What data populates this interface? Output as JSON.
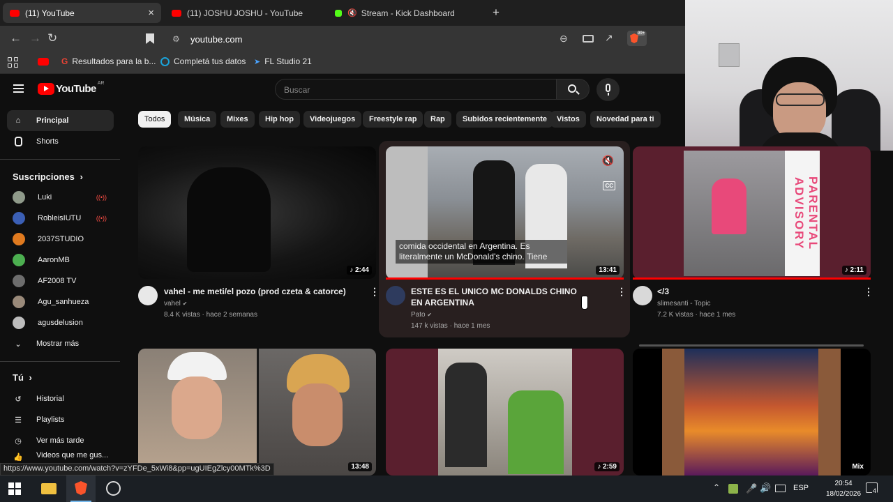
{
  "browser": {
    "tabs": [
      {
        "label": "(11) YouTube",
        "active": true
      },
      {
        "label": "(11) JOSHU JOSHU - YouTube",
        "active": false
      },
      {
        "label": "Stream - Kick Dashboard",
        "active": false
      }
    ],
    "new_tab": "+",
    "close_tab": "×",
    "url": "youtube.com",
    "shields_badge": "99+",
    "bookmarks": [
      {
        "label": "Resultados para la b..."
      },
      {
        "label": "Completá tus datos"
      },
      {
        "label": "FL Studio 21"
      }
    ],
    "status_url": "https://www.youtube.com/watch?v=zYFDe_5xWi8&pp=ugUIEgZlcy00MTk%3D"
  },
  "youtube": {
    "logo": "YouTube",
    "logo_country": "AR",
    "search_placeholder": "Buscar",
    "sidebar": {
      "main": [
        {
          "label": "Principal",
          "icon": "home-icon",
          "active": true
        },
        {
          "label": "Shorts",
          "icon": "shorts-icon",
          "active": false
        }
      ],
      "subs_header": "Suscripciones",
      "subscriptions": [
        {
          "label": "Luki",
          "live": true,
          "color": "#8f9a8a"
        },
        {
          "label": "RobleisIUTU",
          "live": true,
          "color": "#3b5fb5"
        },
        {
          "label": "2037STUDIO",
          "live": false,
          "color": "#e07a1f"
        },
        {
          "label": "AaronMB",
          "live": false,
          "color": "#4caf50"
        },
        {
          "label": "AF2008 TV",
          "live": false,
          "color": "#6d6d6d"
        },
        {
          "label": "Agu_sanhueza",
          "live": false,
          "color": "#9a8a7a"
        },
        {
          "label": "agusdelusion",
          "live": false,
          "color": "#bdbdbd"
        }
      ],
      "show_more": "Mostrar más",
      "you_header": "Tú",
      "you_items": [
        {
          "label": "Historial",
          "icon": "history-icon"
        },
        {
          "label": "Playlists",
          "icon": "playlists-icon"
        },
        {
          "label": "Ver más tarde",
          "icon": "watch-later-icon"
        },
        {
          "label": "Videos que me gus...",
          "icon": "liked-icon"
        }
      ]
    },
    "chips": [
      "Todos",
      "Música",
      "Mixes",
      "Hip hop",
      "Videojuegos",
      "Freestyle rap",
      "Rap",
      "Subidos recientemente",
      "Vistos",
      "Novedad para ti"
    ],
    "videos": [
      {
        "title": "vahel - me meti/el pozo (prod czeta & catorce)",
        "channel": "vahel",
        "verified": true,
        "meta": "8.4 K vistas · hace 2 semanas",
        "duration": "♪ 2:44"
      },
      {
        "title": "ESTE ES EL UNICO MC DONALDS CHINO EN ARGENTINA",
        "channel": "Pato",
        "verified": true,
        "meta": "147 k vistas · hace 1 mes",
        "duration": "13:41",
        "caption": "comida occidental en Argentina. Es literalmente un McDonald's chino. Tiene"
      },
      {
        "title": "</3",
        "channel": "slimesanti - Topic",
        "verified": false,
        "meta": "7.2 K vistas · hace 1 mes",
        "duration": "♪ 2:11",
        "advisory": "PARENTAL ADVISORY"
      },
      {
        "duration": "13:48"
      },
      {
        "duration": "♪ 2:59"
      },
      {
        "duration": "Mix"
      }
    ]
  },
  "taskbar": {
    "lang": "ESP",
    "time": "20:54",
    "date": "18/02/2026",
    "notifications": "4"
  }
}
